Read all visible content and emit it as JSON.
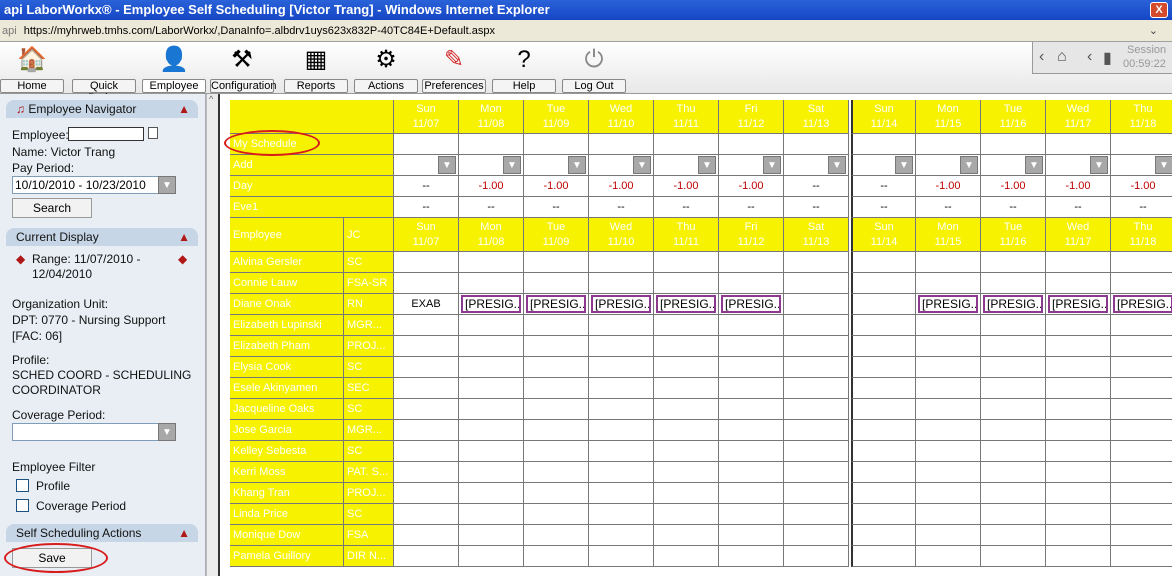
{
  "window": {
    "title": "api LaborWorkx® - Employee Self Scheduling [Victor Trang] - Windows Internet Explorer",
    "close_glyph": "X"
  },
  "address": {
    "prefix": "api",
    "url": "https://myhrweb.tmhs.com/LaborWorkx/,DanaInfo=.albdrv1uys623x832P-40TC84E+Default.aspx"
  },
  "toolbar": {
    "items": [
      {
        "label": "Home",
        "icon": "house-icon"
      },
      {
        "label": "Quick Badge",
        "icon": "badge-icon"
      },
      {
        "label": "Employee",
        "icon": "person-icon"
      },
      {
        "label": "Configuration",
        "icon": "tools-icon"
      },
      {
        "label": "Reports",
        "icon": "calendar-report-icon"
      },
      {
        "label": "Actions",
        "icon": "gear-icon"
      },
      {
        "label": "Preferences",
        "icon": "paint-icon"
      },
      {
        "label": "Help",
        "icon": "help-icon"
      },
      {
        "label": "Log Out",
        "icon": "power-icon"
      }
    ],
    "session_label": "Session",
    "session_time": "00:59:22"
  },
  "navigator": {
    "header": "Employee Navigator",
    "employee_label": "Employee:",
    "name_text": "Name: Victor Trang",
    "pay_period_label": "Pay Period:",
    "pay_period_value": "10/10/2010 - 10/23/2010",
    "search_button": "Search",
    "current_display_header": "Current Display",
    "range_line1": "Range: 11/07/2010 -",
    "range_line2": "12/04/2010",
    "org_unit_label": "Organization Unit:",
    "org_unit_line1": "DPT: 0770 - Nursing Support",
    "org_unit_line2": "[FAC: 06]",
    "profile_label": "Profile:",
    "profile_line1": "SCHED COORD - SCHEDULING",
    "profile_line2": "COORDINATOR",
    "coverage_period_label": "Coverage Period:",
    "employee_filter_label": "Employee Filter",
    "filter_profile": "Profile",
    "filter_coverage": "Coverage Period",
    "self_sched_header": "Self Scheduling Actions",
    "save_button": "Save"
  },
  "schedule": {
    "days": [
      {
        "dow": "Sun",
        "date": "11/07"
      },
      {
        "dow": "Mon",
        "date": "11/08"
      },
      {
        "dow": "Tue",
        "date": "11/09"
      },
      {
        "dow": "Wed",
        "date": "11/10"
      },
      {
        "dow": "Thu",
        "date": "11/11"
      },
      {
        "dow": "Fri",
        "date": "11/12"
      },
      {
        "dow": "Sat",
        "date": "11/13"
      },
      {
        "dow": "Sun",
        "date": "11/14"
      },
      {
        "dow": "Mon",
        "date": "11/15"
      },
      {
        "dow": "Tue",
        "date": "11/16"
      },
      {
        "dow": "Wed",
        "date": "11/17"
      },
      {
        "dow": "Thu",
        "date": "11/18"
      }
    ],
    "row_labels": {
      "my_schedule": "My Schedule",
      "add": "Add",
      "day": "Day",
      "eve1": "Eve1",
      "employee": "Employee",
      "jc": "JC"
    },
    "day_values": [
      "--",
      "-1.00",
      "-1.00",
      "-1.00",
      "-1.00",
      "-1.00",
      "--",
      "--",
      "-1.00",
      "-1.00",
      "-1.00",
      "-1.00"
    ],
    "eve1_values": [
      "--",
      "--",
      "--",
      "--",
      "--",
      "--",
      "--",
      "--",
      "--",
      "--",
      "--",
      "--"
    ],
    "employees": [
      {
        "name": "Alvina Gersler",
        "jc": "SC",
        "shifts": [
          "",
          "",
          "",
          "",
          "",
          "",
          "",
          "",
          "",
          "",
          "",
          ""
        ]
      },
      {
        "name": "Connie Lauw",
        "jc": "FSA-SR",
        "shifts": [
          "",
          "",
          "",
          "",
          "",
          "",
          "",
          "",
          "",
          "",
          "",
          ""
        ]
      },
      {
        "name": "Diane Onak",
        "jc": "RN",
        "shifts": [
          "EXAB",
          "[PRESIG...",
          "[PRESIG...",
          "[PRESIG...",
          "[PRESIG...",
          "[PRESIG...",
          "",
          "",
          "[PRESIG...",
          "[PRESIG...",
          "[PRESIG...",
          "[PRESIG..."
        ]
      },
      {
        "name": "Elizabeth Lupinski",
        "jc": "MGR...",
        "shifts": [
          "",
          "",
          "",
          "",
          "",
          "",
          "",
          "",
          "",
          "",
          "",
          ""
        ]
      },
      {
        "name": "Elizabeth Pham",
        "jc": "PROJ...",
        "shifts": [
          "",
          "",
          "",
          "",
          "",
          "",
          "",
          "",
          "",
          "",
          "",
          ""
        ]
      },
      {
        "name": "Elysia Cook",
        "jc": "SC",
        "shifts": [
          "",
          "",
          "",
          "",
          "",
          "",
          "",
          "",
          "",
          "",
          "",
          ""
        ]
      },
      {
        "name": "Esele Akinyamen",
        "jc": "SEC",
        "shifts": [
          "",
          "",
          "",
          "",
          "",
          "",
          "",
          "",
          "",
          "",
          "",
          ""
        ]
      },
      {
        "name": "Jacqueline Oaks",
        "jc": "SC",
        "shifts": [
          "",
          "",
          "",
          "",
          "",
          "",
          "",
          "",
          "",
          "",
          "",
          ""
        ]
      },
      {
        "name": "Jose Garcia",
        "jc": "MGR...",
        "shifts": [
          "",
          "",
          "",
          "",
          "",
          "",
          "",
          "",
          "",
          "",
          "",
          ""
        ]
      },
      {
        "name": "Kelley Sebesta",
        "jc": "SC",
        "shifts": [
          "",
          "",
          "",
          "",
          "",
          "",
          "",
          "",
          "",
          "",
          "",
          ""
        ]
      },
      {
        "name": "Kerri Moss",
        "jc": "PAT. S...",
        "shifts": [
          "",
          "",
          "",
          "",
          "",
          "",
          "",
          "",
          "",
          "",
          "",
          ""
        ]
      },
      {
        "name": "Khang Tran",
        "jc": "PROJ...",
        "shifts": [
          "",
          "",
          "",
          "",
          "",
          "",
          "",
          "",
          "",
          "",
          "",
          ""
        ]
      },
      {
        "name": "Linda Price",
        "jc": "SC",
        "shifts": [
          "",
          "",
          "",
          "",
          "",
          "",
          "",
          "",
          "",
          "",
          "",
          ""
        ]
      },
      {
        "name": "Monique Dow",
        "jc": "FSA",
        "shifts": [
          "",
          "",
          "",
          "",
          "",
          "",
          "",
          "",
          "",
          "",
          "",
          ""
        ]
      },
      {
        "name": "Pamela Guillory",
        "jc": "DIR N...",
        "shifts": [
          "",
          "",
          "",
          "",
          "",
          "",
          "",
          "",
          "",
          "",
          "",
          ""
        ]
      }
    ]
  },
  "colors": {
    "header_yellow": "#f6f200",
    "shift_border": "#8b3a8f",
    "annotation_red": "#d81b1b"
  }
}
